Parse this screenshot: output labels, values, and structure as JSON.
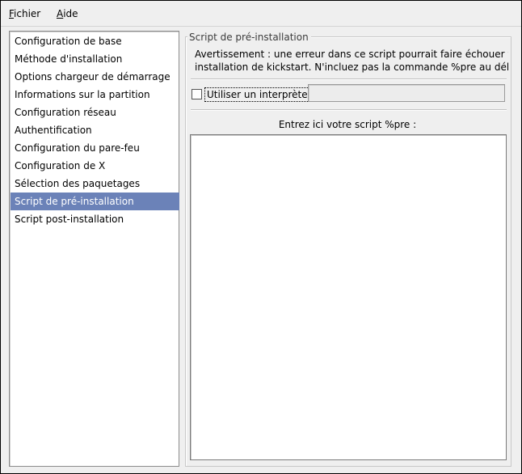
{
  "menubar": {
    "items": [
      {
        "mnemonic": "F",
        "rest": "ichier"
      },
      {
        "mnemonic": "A",
        "rest": "ide"
      }
    ]
  },
  "sidebar": {
    "items": [
      {
        "label": "Configuration de base"
      },
      {
        "label": "Méthode d'installation"
      },
      {
        "label": "Options chargeur de démarrage"
      },
      {
        "label": "Informations sur la partition"
      },
      {
        "label": "Configuration réseau"
      },
      {
        "label": "Authentification"
      },
      {
        "label": "Configuration du pare-feu"
      },
      {
        "label": "Configuration de X"
      },
      {
        "label": "Sélection des paquetages"
      },
      {
        "label": "Script de pré-installation"
      },
      {
        "label": "Script post-installation"
      }
    ],
    "selected_index": 9,
    "selected_color": "#6b82b8"
  },
  "panel": {
    "title": "Script de pré-installation",
    "warning_line1": "Avertissement : une erreur dans ce script pourrait faire échouer vot",
    "warning_line2": "installation de kickstart. N'incluez pas la commande %pre au débu",
    "interpreter_checkbox_checked": false,
    "interpreter_label": "Utiliser un interprète :",
    "interpreter_value": "",
    "script_label": "Entrez ici votre script %pre :",
    "script_value": ""
  }
}
